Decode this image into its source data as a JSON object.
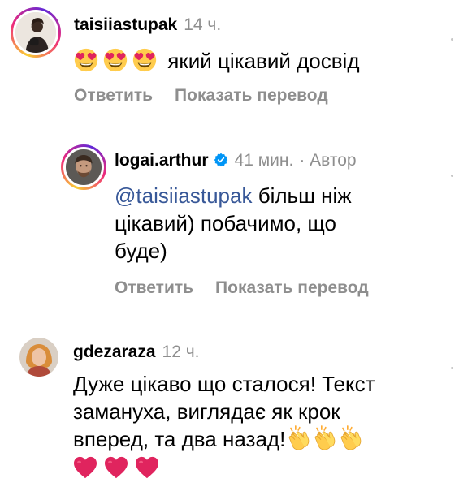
{
  "comments": [
    {
      "username": "taisiiastupak",
      "time": "14 ч.",
      "emoji_prefix": [
        "smiling-heart-eyes",
        "smiling-heart-eyes",
        "smiling-heart-eyes"
      ],
      "text": "який цікавий досвід",
      "reply_label": "Ответить",
      "translate_label": "Показать перевод"
    },
    {
      "username": "logai.arthur",
      "verified": true,
      "time": "41 мин.",
      "author_label": "· Автор",
      "mention": "@taisiiastupak",
      "text_line1": " більш ніж",
      "text_line2": "цікавий) побачимо, що",
      "text_line3": "буде)",
      "reply_label": "Ответить",
      "translate_label": "Показать перевод"
    },
    {
      "username": "gdezaraza",
      "time": "12 ч.",
      "text_line1": "Дуже цікаво що сталося! Текст",
      "text_line2": "замануха, виглядає як крок",
      "text_line3": "вперед, та два назад!",
      "emoji_suffix": [
        "clapping-hands",
        "clapping-hands",
        "clapping-hands"
      ],
      "hearts": [
        "red-heart",
        "red-heart",
        "red-heart"
      ]
    }
  ],
  "colors": {
    "secondary_text": "#8e8e8e",
    "mention": "#385898",
    "verified_badge": "#0095f6",
    "heart": "#e0245e"
  }
}
